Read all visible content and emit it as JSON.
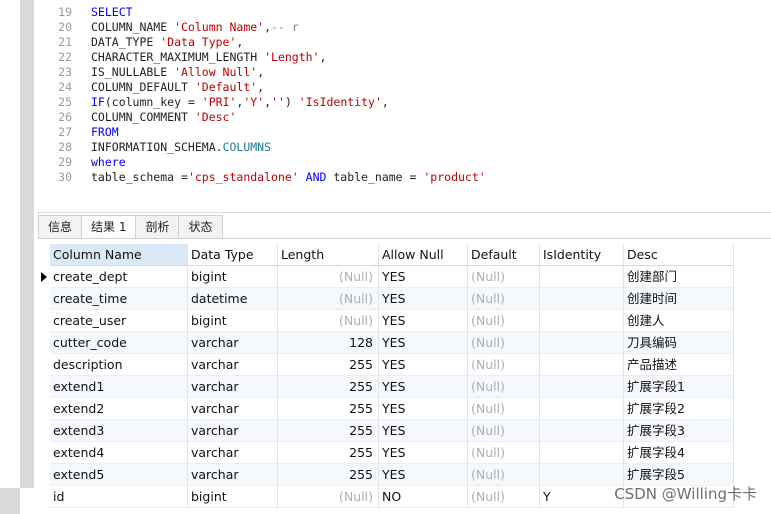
{
  "editor": {
    "lines": [
      {
        "num": "19",
        "parts": [
          {
            "t": "SELECT",
            "c": "kw"
          }
        ]
      },
      {
        "num": "20",
        "parts": [
          {
            "t": "COLUMN_NAME ",
            "c": ""
          },
          {
            "t": "'Column Name'",
            "c": "str"
          },
          {
            "t": ",",
            "c": ""
          },
          {
            "t": "-- r",
            "c": "cm"
          }
        ]
      },
      {
        "num": "21",
        "parts": [
          {
            "t": "DATA_TYPE ",
            "c": ""
          },
          {
            "t": "'Data Type'",
            "c": "str"
          },
          {
            "t": ",",
            "c": ""
          }
        ]
      },
      {
        "num": "22",
        "parts": [
          {
            "t": "CHARACTER_MAXIMUM_LENGTH ",
            "c": ""
          },
          {
            "t": "'Length'",
            "c": "str"
          },
          {
            "t": ",",
            "c": ""
          }
        ]
      },
      {
        "num": "23",
        "parts": [
          {
            "t": "IS_NULLABLE ",
            "c": ""
          },
          {
            "t": "'Allow Null'",
            "c": "str"
          },
          {
            "t": ",",
            "c": ""
          }
        ]
      },
      {
        "num": "24",
        "parts": [
          {
            "t": "COLUMN_DEFAULT ",
            "c": ""
          },
          {
            "t": "'Default'",
            "c": "str"
          },
          {
            "t": ",",
            "c": ""
          }
        ]
      },
      {
        "num": "25",
        "parts": [
          {
            "t": "IF",
            "c": "kw"
          },
          {
            "t": "(column_key = ",
            "c": ""
          },
          {
            "t": "'PRI'",
            "c": "str"
          },
          {
            "t": ",",
            "c": ""
          },
          {
            "t": "'Y'",
            "c": "str"
          },
          {
            "t": ",",
            "c": ""
          },
          {
            "t": "''",
            "c": "str"
          },
          {
            "t": ") ",
            "c": ""
          },
          {
            "t": "'IsIdentity'",
            "c": "str"
          },
          {
            "t": ",",
            "c": ""
          }
        ]
      },
      {
        "num": "26",
        "parts": [
          {
            "t": "COLUMN_COMMENT ",
            "c": ""
          },
          {
            "t": "'Desc'",
            "c": "str"
          }
        ]
      },
      {
        "num": "27",
        "parts": [
          {
            "t": "FROM",
            "c": "kw"
          }
        ]
      },
      {
        "num": "28",
        "parts": [
          {
            "t": "INFORMATION_SCHEMA.",
            "c": ""
          },
          {
            "t": "COLUMNS",
            "c": "ident"
          }
        ]
      },
      {
        "num": "29",
        "parts": [
          {
            "t": "where",
            "c": "kw"
          }
        ]
      },
      {
        "num": "30",
        "parts": [
          {
            "t": "table_schema =",
            "c": ""
          },
          {
            "t": "'cps_standalone'",
            "c": "str"
          },
          {
            "t": " ",
            "c": ""
          },
          {
            "t": "AND",
            "c": "kw"
          },
          {
            "t": " table_name = ",
            "c": ""
          },
          {
            "t": "'product'",
            "c": "str"
          }
        ]
      }
    ]
  },
  "tabs": [
    {
      "label": "信息",
      "active": false
    },
    {
      "label": "结果 1",
      "active": true
    },
    {
      "label": "剖析",
      "active": false
    },
    {
      "label": "状态",
      "active": false
    }
  ],
  "grid": {
    "columns": [
      "Column Name",
      "Data Type",
      "Length",
      "Allow Null",
      "Default",
      "IsIdentity",
      "Desc"
    ],
    "rows": [
      [
        "create_dept",
        "bigint",
        "(Null)",
        "YES",
        "(Null)",
        "",
        "创建部门"
      ],
      [
        "create_time",
        "datetime",
        "(Null)",
        "YES",
        "(Null)",
        "",
        "创建时间"
      ],
      [
        "create_user",
        "bigint",
        "(Null)",
        "YES",
        "(Null)",
        "",
        "创建人"
      ],
      [
        "cutter_code",
        "varchar",
        "128",
        "YES",
        "(Null)",
        "",
        "刀具编码"
      ],
      [
        "description",
        "varchar",
        "255",
        "YES",
        "(Null)",
        "",
        "产品描述"
      ],
      [
        "extend1",
        "varchar",
        "255",
        "YES",
        "(Null)",
        "",
        "扩展字段1"
      ],
      [
        "extend2",
        "varchar",
        "255",
        "YES",
        "(Null)",
        "",
        "扩展字段2"
      ],
      [
        "extend3",
        "varchar",
        "255",
        "YES",
        "(Null)",
        "",
        "扩展字段3"
      ],
      [
        "extend4",
        "varchar",
        "255",
        "YES",
        "(Null)",
        "",
        "扩展字段4"
      ],
      [
        "extend5",
        "varchar",
        "255",
        "YES",
        "(Null)",
        "",
        "扩展字段5"
      ],
      [
        "id",
        "bigint",
        "(Null)",
        "NO",
        "(Null)",
        "Y",
        ""
      ]
    ]
  },
  "watermark": "CSDN @Willing卡卡"
}
